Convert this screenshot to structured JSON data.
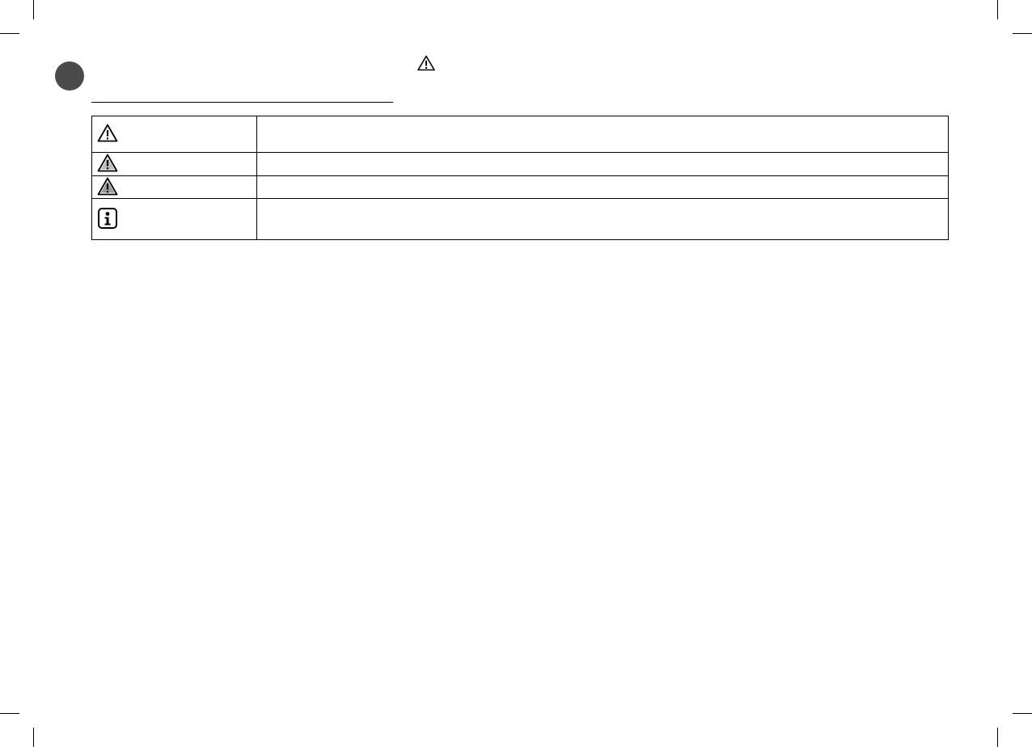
{
  "page": {
    "header": {
      "badge_icon": "section-circle-icon",
      "warning_icon": "warning-triangle-icon"
    },
    "symbol_table": {
      "rows": [
        {
          "icon": "warning-triangle-icon",
          "description": ""
        },
        {
          "icon": "warning-triangle-icon",
          "description": ""
        },
        {
          "icon": "warning-triangle-icon",
          "description": ""
        },
        {
          "icon": "information-icon",
          "description": ""
        }
      ]
    },
    "colors": {
      "badge": "#4b4b4b",
      "lines": "#000000"
    }
  }
}
